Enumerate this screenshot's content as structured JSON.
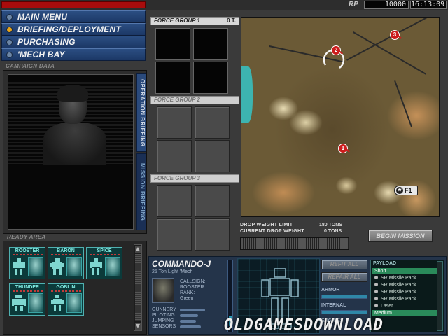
{
  "header": {
    "rp_label": "RP",
    "rp_value": "10000",
    "clock": "16:13:09"
  },
  "menu": [
    {
      "label": "MAIN MENU",
      "active": false
    },
    {
      "label": "BRIEFING/DEPLOYMENT",
      "active": true
    },
    {
      "label": "PURCHASING",
      "active": false
    },
    {
      "label": "'MECH BAY",
      "active": false
    }
  ],
  "campaign": {
    "title": "CAMPAIGN DATA",
    "tab_operation": "OPERATION BRIEFING",
    "tab_mission": "MISSION BRIEFING"
  },
  "ready_area": {
    "title": "READY AREA",
    "pilots": [
      {
        "name": "ROOSTER"
      },
      {
        "name": "BARON"
      },
      {
        "name": "SPICE"
      },
      {
        "name": "THUNDER"
      },
      {
        "name": "GOBLIN"
      }
    ]
  },
  "force_groups": [
    {
      "label": "FORCE GROUP 1",
      "count": "0 T."
    },
    {
      "label": "FORCE GROUP 2",
      "count": ""
    },
    {
      "label": "FORCE GROUP 3",
      "count": ""
    }
  ],
  "map": {
    "markers": [
      "1",
      "2",
      "3"
    ],
    "force_tag": "F1"
  },
  "drop": {
    "limit_label": "DROP WEIGHT LIMIT",
    "limit_value": "180 TONS",
    "current_label": "CURRENT DROP WEIGHT",
    "current_value": "0 TONS",
    "begin_button": "BEGIN MISSION"
  },
  "mech": {
    "name": "COMMANDO-J",
    "subtitle": "25 Ton Light 'Mech",
    "callsign_label": "CALLSIGN:",
    "callsign": "ROOSTER",
    "rank_label": "RANK:",
    "rank": "Green",
    "skills": [
      {
        "label": "GUNNERY",
        "level": 0.55
      },
      {
        "label": "PILOTING",
        "level": 0.4
      },
      {
        "label": "JUMPING",
        "level": 0.35
      },
      {
        "label": "SENSORS",
        "level": 0.45
      }
    ],
    "refit_button": "REFIT ALL",
    "repair_button": "REPAIR ALL",
    "armor_label": "ARMOR",
    "internal_label": "INTERNAL",
    "engines_label": "ENGINES",
    "payload_title": "PAYLOAD",
    "payload": [
      {
        "text": "Short",
        "selected": true
      },
      {
        "text": "SR Missile Pack",
        "selected": false
      },
      {
        "text": "SR Missile Pack",
        "selected": false
      },
      {
        "text": "SR Missile Pack",
        "selected": false
      },
      {
        "text": "SR Missile Pack",
        "selected": false
      },
      {
        "text": "Laser",
        "selected": false
      },
      {
        "text": "Medium",
        "selected": true
      }
    ]
  },
  "watermark": "OLDGAMESDOWNLOAD"
}
